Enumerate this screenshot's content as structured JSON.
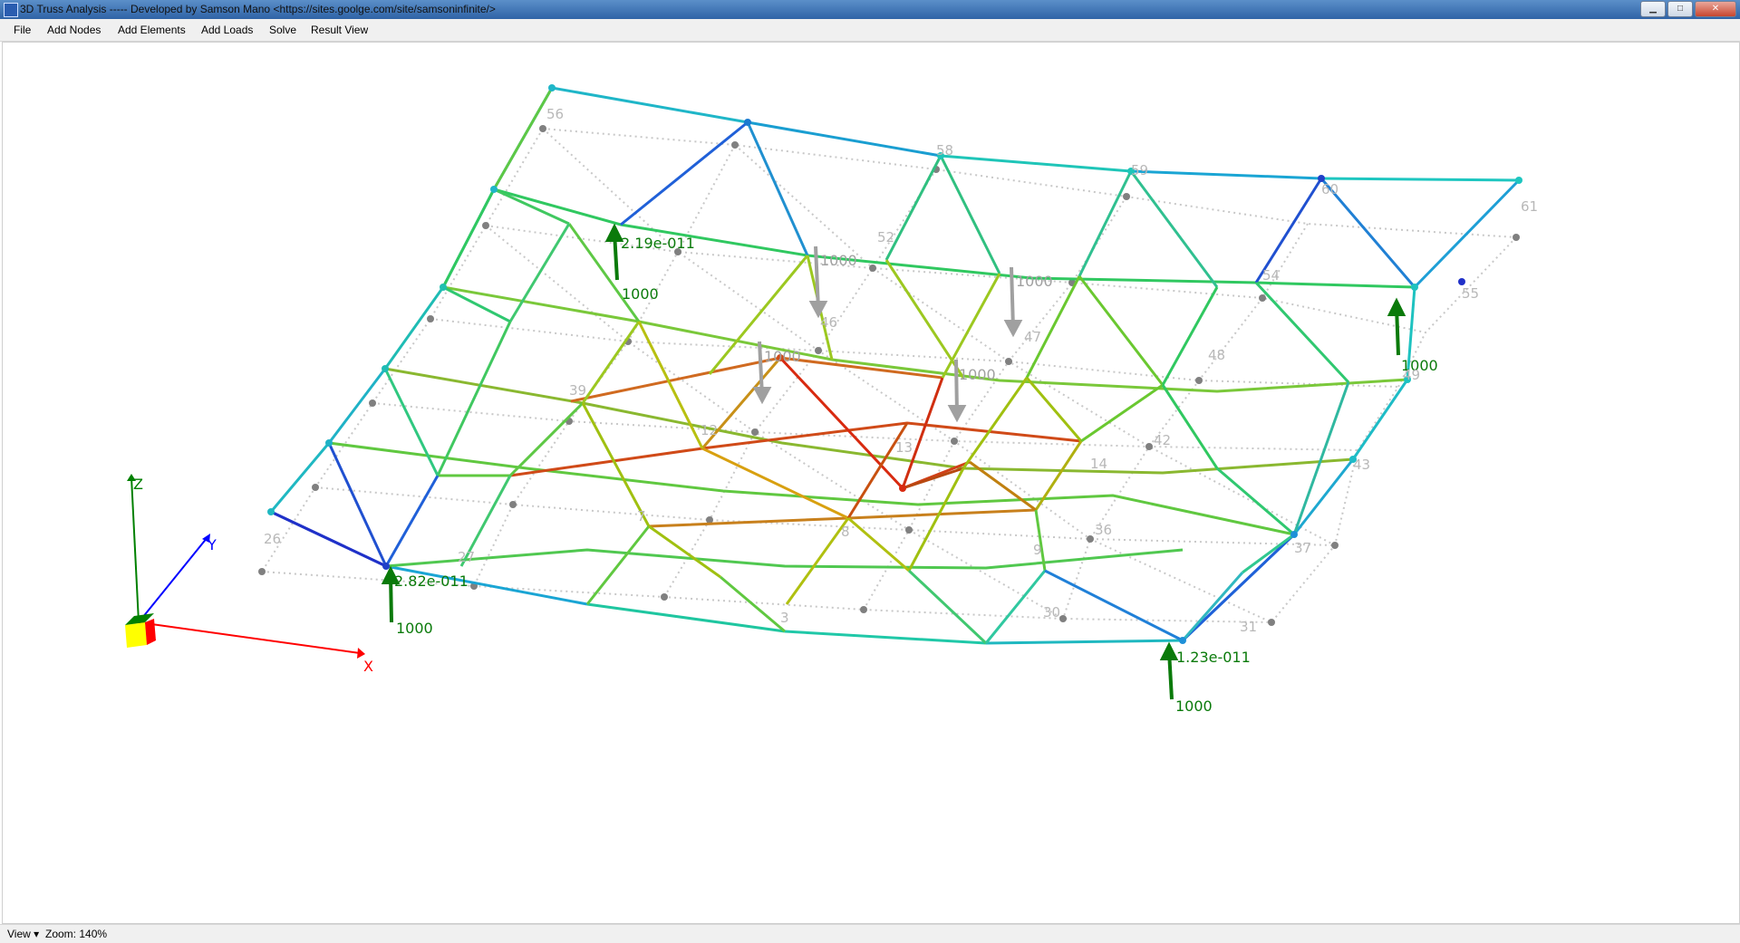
{
  "window": {
    "title": "3D Truss Analysis ----- Developed by Samson Mano <https://sites.goolge.com/site/samsoninfinite/>",
    "controls": [
      "minimize-icon",
      "maximize-icon",
      "close-icon"
    ]
  },
  "menu": {
    "items": [
      "File",
      "Add Nodes",
      "Add Elements",
      "Add Loads",
      "Solve",
      "Result View"
    ]
  },
  "axes": {
    "x": "X",
    "y": "Y",
    "z": "Z",
    "colors": {
      "x": "#ff0000",
      "y": "#0000ff",
      "z": "#008000"
    }
  },
  "nodes_labels": [
    "56",
    "58",
    "59",
    "60",
    "61",
    "52",
    "54",
    "55",
    "46",
    "47",
    "48",
    "49",
    "39",
    "13",
    "12",
    "14",
    "42",
    "43",
    "7",
    "8",
    "9",
    "36",
    "37",
    "26",
    "27",
    "30",
    "31",
    "3",
    "48"
  ],
  "loads": {
    "value": "1000",
    "reaction_values": [
      "2.19e-011",
      "2.82e-011",
      "1.23e-011"
    ]
  },
  "status": {
    "view": "View",
    "zoom": "Zoom: 140%"
  }
}
